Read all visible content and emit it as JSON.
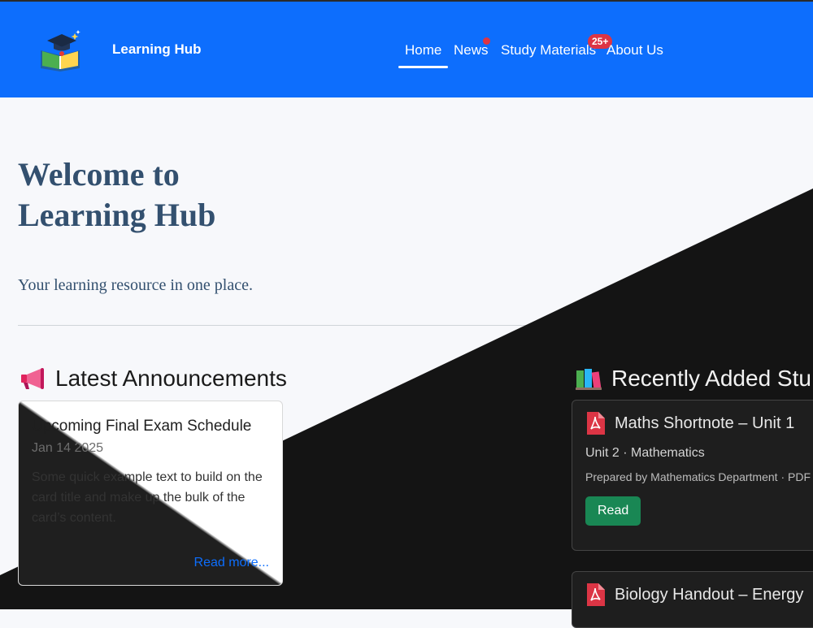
{
  "navbar": {
    "brand": "Learning Hub",
    "links": [
      {
        "label": "Home",
        "active": true
      },
      {
        "label": "News",
        "has_dot": true
      },
      {
        "label": "Study Materials",
        "badge": "25+"
      },
      {
        "label": "About Us"
      }
    ],
    "colors": {
      "background": "#0d6efd",
      "badge": "#dc3545"
    }
  },
  "hero": {
    "title": "Welcome to\nLearning Hub",
    "subtitle": "Your learning resource in one place."
  },
  "announcements": {
    "heading": "Latest Announcements",
    "icon": "megaphone-icon",
    "items": [
      {
        "title": "Upcoming Final Exam Schedule",
        "date": "Jan 14 2025",
        "text": "Some quick example text to build on the card title and make up the bulk of the card’s content.",
        "link": "Read more..."
      }
    ]
  },
  "materials": {
    "heading": "Recently Added Stu",
    "icon": "books-icon",
    "items": [
      {
        "title": "Maths Shortnote – Unit 1",
        "meta": "Unit 2 · Mathematics",
        "prepared": "Prepared by Mathematics Department · PDF",
        "button": "Read",
        "icon": "pdf-icon"
      },
      {
        "title": "Biology Handout – Energy",
        "icon": "pdf-icon"
      }
    ],
    "colors": {
      "button": "#198754"
    }
  }
}
